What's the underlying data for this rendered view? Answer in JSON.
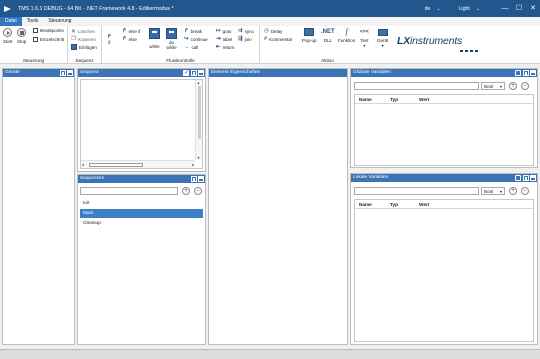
{
  "window": {
    "title": "TMS 1.6.1 DEBUG - 64 Bit - .NET Framework 4.8 - Editiermodus *",
    "language": "de",
    "theme": "Light",
    "minimize": "—",
    "maximize": "☐",
    "close": "✕"
  },
  "menu": {
    "items": [
      "Datei",
      "Tools",
      "Steuerung"
    ],
    "active_index": 0
  },
  "ribbon": {
    "steuerung": {
      "label": "Steuerung",
      "start": "Start",
      "stop": "Stop",
      "breakpoints": "Breakpoints",
      "einzelschritt": "Einzelschritt"
    },
    "sequenz": {
      "label": "Sequenz",
      "loeschen": "Löschen",
      "kopieren": "Kopieren",
      "einfuegen": "Einfügen"
    },
    "flusskontrolle": {
      "label": "Flusskontrolle",
      "if": "if",
      "else_if": "else if",
      "else": "else",
      "while": "while",
      "do_while_1": "do",
      "do_while_2": "while",
      "break": "break",
      "continue": "continue",
      "call": "call",
      "goto": "goto",
      "label_item": "label",
      "return": "return",
      "sync": "sync",
      "join": "join"
    },
    "aktion": {
      "label": "Aktion",
      "delay": "Delay",
      "kommentar": "Kommentar",
      "popup": "Pop-up",
      "dll_top": ".NET",
      "dll": "DLL",
      "funktion_icon": "f",
      "funktion": "Funktion",
      "text_icon": "<=<",
      "text": "Text",
      "geraet": "Gerät"
    },
    "logo": {
      "lx": "LX",
      "instruments": "instruments"
    }
  },
  "panels": {
    "geraete": {
      "title": "Geräte"
    },
    "sequenz": {
      "title": "Sequenz"
    },
    "sequenzen": {
      "title": "Sequenzen",
      "add": "+",
      "remove": "−",
      "items": [
        "Init",
        "Main",
        "Cleanup"
      ],
      "selected_index": 1
    },
    "element_eigenschaften": {
      "title": "Element Eigenschaften"
    },
    "globale_variablen": {
      "title": "Globale Variablen",
      "type_value": "Bool",
      "add": "+",
      "remove": "−",
      "columns": [
        "Name",
        "Typ",
        "Wert"
      ]
    },
    "lokale_variablen": {
      "title": "Lokale Variablen",
      "type_value": "Bool",
      "add": "+",
      "remove": "−",
      "columns": [
        "Name",
        "Typ",
        "Wert"
      ]
    }
  },
  "colors": {
    "titlebar": "#22578d",
    "panel_header": "#3a74b6",
    "selection": "#3d7fc7",
    "workspace": "#f0f0f0"
  }
}
